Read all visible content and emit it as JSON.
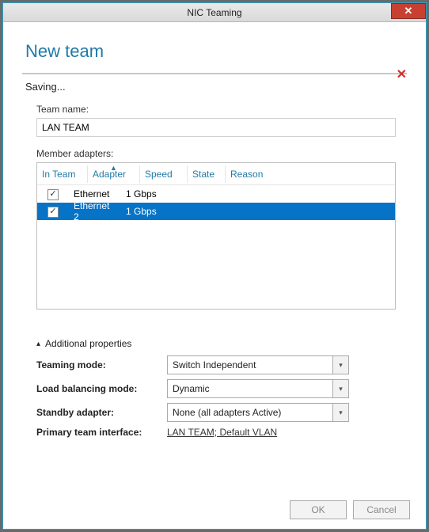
{
  "window": {
    "title": "NIC Teaming"
  },
  "heading": "New team",
  "status": "Saving...",
  "teamName": {
    "label": "Team name:",
    "value": "LAN TEAM"
  },
  "memberAdapters": {
    "label": "Member adapters:",
    "columns": {
      "inTeam": "In Team",
      "adapter": "Adapter",
      "speed": "Speed",
      "state": "State",
      "reason": "Reason"
    },
    "rows": [
      {
        "checked": true,
        "adapter": "Ethernet",
        "speed": "1 Gbps",
        "state": "",
        "reason": "",
        "selected": false
      },
      {
        "checked": true,
        "adapter": "Ethernet 2",
        "speed": "1 Gbps",
        "state": "",
        "reason": "",
        "selected": true
      }
    ]
  },
  "additional": {
    "label": "Additional properties",
    "teamingMode": {
      "label": "Teaming mode:",
      "value": "Switch Independent"
    },
    "loadBalancing": {
      "label": "Load balancing mode:",
      "value": "Dynamic"
    },
    "standby": {
      "label": "Standby adapter:",
      "value": "None (all adapters Active)"
    },
    "primaryIf": {
      "label": "Primary team interface:",
      "value": "LAN TEAM; Default VLAN"
    }
  },
  "buttons": {
    "ok": "OK",
    "cancel": "Cancel"
  }
}
